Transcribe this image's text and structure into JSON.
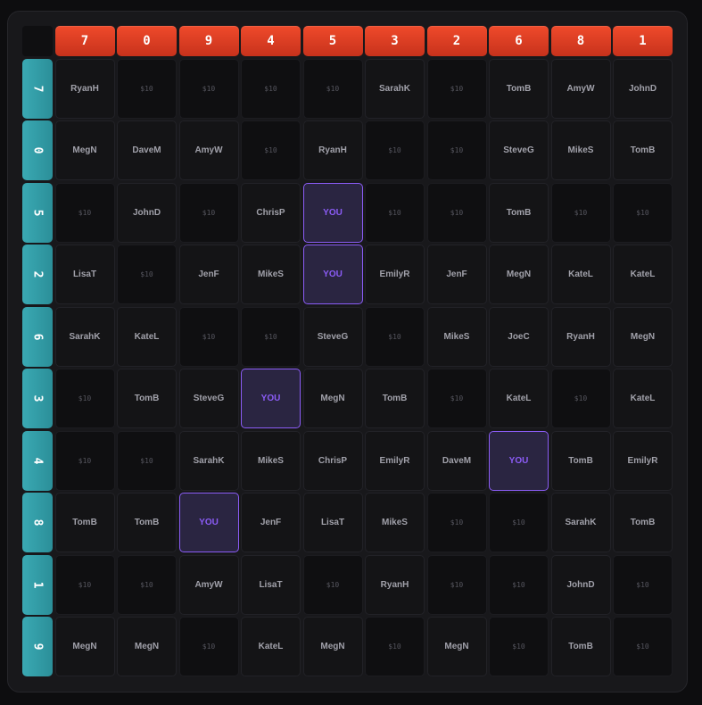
{
  "columns": [
    "7",
    "0",
    "9",
    "4",
    "5",
    "3",
    "2",
    "6",
    "8",
    "1"
  ],
  "rows": [
    {
      "label": "7",
      "cells": [
        "RyanH",
        "$10",
        "$10",
        "$10",
        "$10",
        "SarahK",
        "$10",
        "TomB",
        "AmyW",
        "JohnD"
      ]
    },
    {
      "label": "0",
      "cells": [
        "MegN",
        "DaveM",
        "AmyW",
        "$10",
        "RyanH",
        "$10",
        "$10",
        "SteveG",
        "MikeS",
        "TomB"
      ]
    },
    {
      "label": "5",
      "cells": [
        "$10",
        "JohnD",
        "$10",
        "ChrisP",
        "YOU",
        "$10",
        "$10",
        "TomB",
        "$10",
        "$10"
      ]
    },
    {
      "label": "2",
      "cells": [
        "LisaT",
        "$10",
        "JenF",
        "MikeS",
        "YOU",
        "EmilyR",
        "JenF",
        "MegN",
        "KateL",
        "KateL"
      ]
    },
    {
      "label": "6",
      "cells": [
        "SarahK",
        "KateL",
        "$10",
        "$10",
        "SteveG",
        "$10",
        "MikeS",
        "JoeC",
        "RyanH",
        "MegN"
      ]
    },
    {
      "label": "3",
      "cells": [
        "$10",
        "TomB",
        "SteveG",
        "YOU",
        "MegN",
        "TomB",
        "$10",
        "KateL",
        "$10",
        "KateL"
      ]
    },
    {
      "label": "4",
      "cells": [
        "$10",
        "$10",
        "SarahK",
        "MikeS",
        "ChrisP",
        "EmilyR",
        "DaveM",
        "YOU",
        "TomB",
        "EmilyR"
      ]
    },
    {
      "label": "8",
      "cells": [
        "TomB",
        "TomB",
        "YOU",
        "JenF",
        "LisaT",
        "MikeS",
        "$10",
        "$10",
        "SarahK",
        "TomB"
      ]
    },
    {
      "label": "1",
      "cells": [
        "$10",
        "$10",
        "AmyW",
        "LisaT",
        "$10",
        "RyanH",
        "$10",
        "$10",
        "JohnD",
        "$10"
      ]
    },
    {
      "label": "9",
      "cells": [
        "MegN",
        "MegN",
        "$10",
        "KateL",
        "MegN",
        "$10",
        "MegN",
        "$10",
        "TomB",
        "$10"
      ]
    }
  ],
  "colors": {
    "column_header": "#e03e22",
    "row_header": "#33a0aa",
    "you_accent": "#8b5cf6",
    "background": "#0d0d0f",
    "panel": "#18181b"
  }
}
